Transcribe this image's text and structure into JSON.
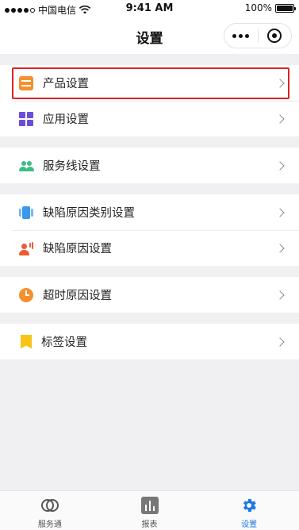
{
  "status_bar": {
    "carrier": "中国电信",
    "time": "9:41 AM",
    "battery": "100%"
  },
  "navbar": {
    "title": "设置"
  },
  "groups": [
    {
      "items": [
        {
          "label": "产品设置",
          "icon": "product-icon"
        },
        {
          "label": "应用设置",
          "icon": "app-grid-icon"
        }
      ]
    },
    {
      "items": [
        {
          "label": "服务线设置",
          "icon": "users-icon"
        }
      ]
    },
    {
      "items": [
        {
          "label": "缺陷原因类别设置",
          "icon": "category-icon"
        },
        {
          "label": "缺陷原因设置",
          "icon": "user-voice-icon"
        }
      ]
    },
    {
      "items": [
        {
          "label": "超时原因设置",
          "icon": "clock-icon"
        }
      ]
    },
    {
      "items": [
        {
          "label": "标签设置",
          "icon": "bookmark-icon"
        }
      ]
    }
  ],
  "tabbar": {
    "tabs": [
      {
        "label": "服务通",
        "icon": "service-logo-icon",
        "active": false
      },
      {
        "label": "报表",
        "icon": "report-chart-icon",
        "active": false
      },
      {
        "label": "设置",
        "icon": "gear-icon",
        "active": true
      }
    ]
  },
  "colors": {
    "highlight_border": "#e02020",
    "active_tab": "#1e78e6"
  }
}
